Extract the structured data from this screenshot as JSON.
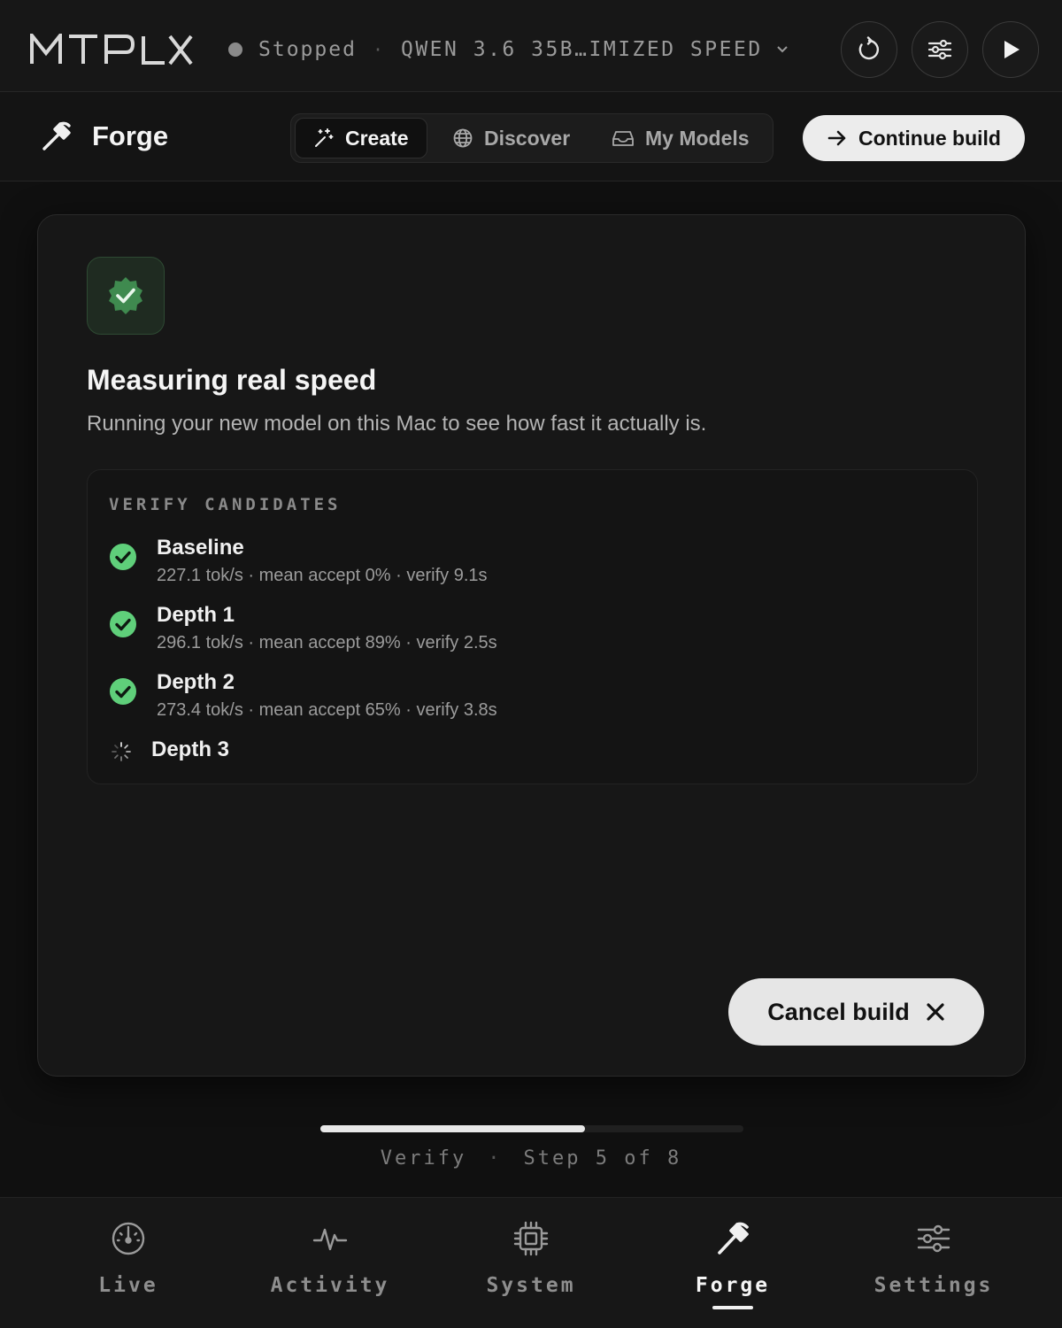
{
  "app": {
    "logo_text": "MTPLX"
  },
  "topbar": {
    "status": "Stopped",
    "separator": "·",
    "model": "QWEN 3.6 35B…IMIZED SPEED",
    "icons": [
      "refresh-icon",
      "sliders-icon",
      "play-icon"
    ]
  },
  "header": {
    "title": "Forge",
    "tabs": [
      {
        "label": "Create",
        "icon": "sparkle-wand-icon",
        "active": true
      },
      {
        "label": "Discover",
        "icon": "globe-icon",
        "active": false
      },
      {
        "label": "My Models",
        "icon": "inbox-icon",
        "active": false
      }
    ],
    "continue_label": "Continue build"
  },
  "card": {
    "title": "Measuring real speed",
    "subtitle": "Running your new model on this Mac to see how fast it actually is.",
    "verify_label": "VERIFY CANDIDATES",
    "candidates": [
      {
        "name": "Baseline",
        "stats": "227.1 tok/s · mean accept 0% · verify 9.1s",
        "state": "done"
      },
      {
        "name": "Depth 1",
        "stats": "296.1 tok/s · mean accept 89% · verify 2.5s",
        "state": "done"
      },
      {
        "name": "Depth 2",
        "stats": "273.4 tok/s · mean accept 65% · verify 3.8s",
        "state": "done"
      },
      {
        "name": "Depth 3",
        "stats": "",
        "state": "running"
      }
    ],
    "cancel_label": "Cancel build"
  },
  "progress": {
    "phase": "Verify",
    "separator": "·",
    "step_text": "Step 5 of 8",
    "fraction": 0.625
  },
  "nav": {
    "items": [
      {
        "label": "Live",
        "icon": "gauge-icon",
        "active": false
      },
      {
        "label": "Activity",
        "icon": "pulse-icon",
        "active": false
      },
      {
        "label": "System",
        "icon": "chip-icon",
        "active": false
      },
      {
        "label": "Forge",
        "icon": "hammer-icon",
        "active": true
      },
      {
        "label": "Settings",
        "icon": "sliders-icon",
        "active": false
      }
    ]
  },
  "colors": {
    "accent_green": "#5fcf7a",
    "button_light": "#ececec",
    "background": "#101010"
  }
}
